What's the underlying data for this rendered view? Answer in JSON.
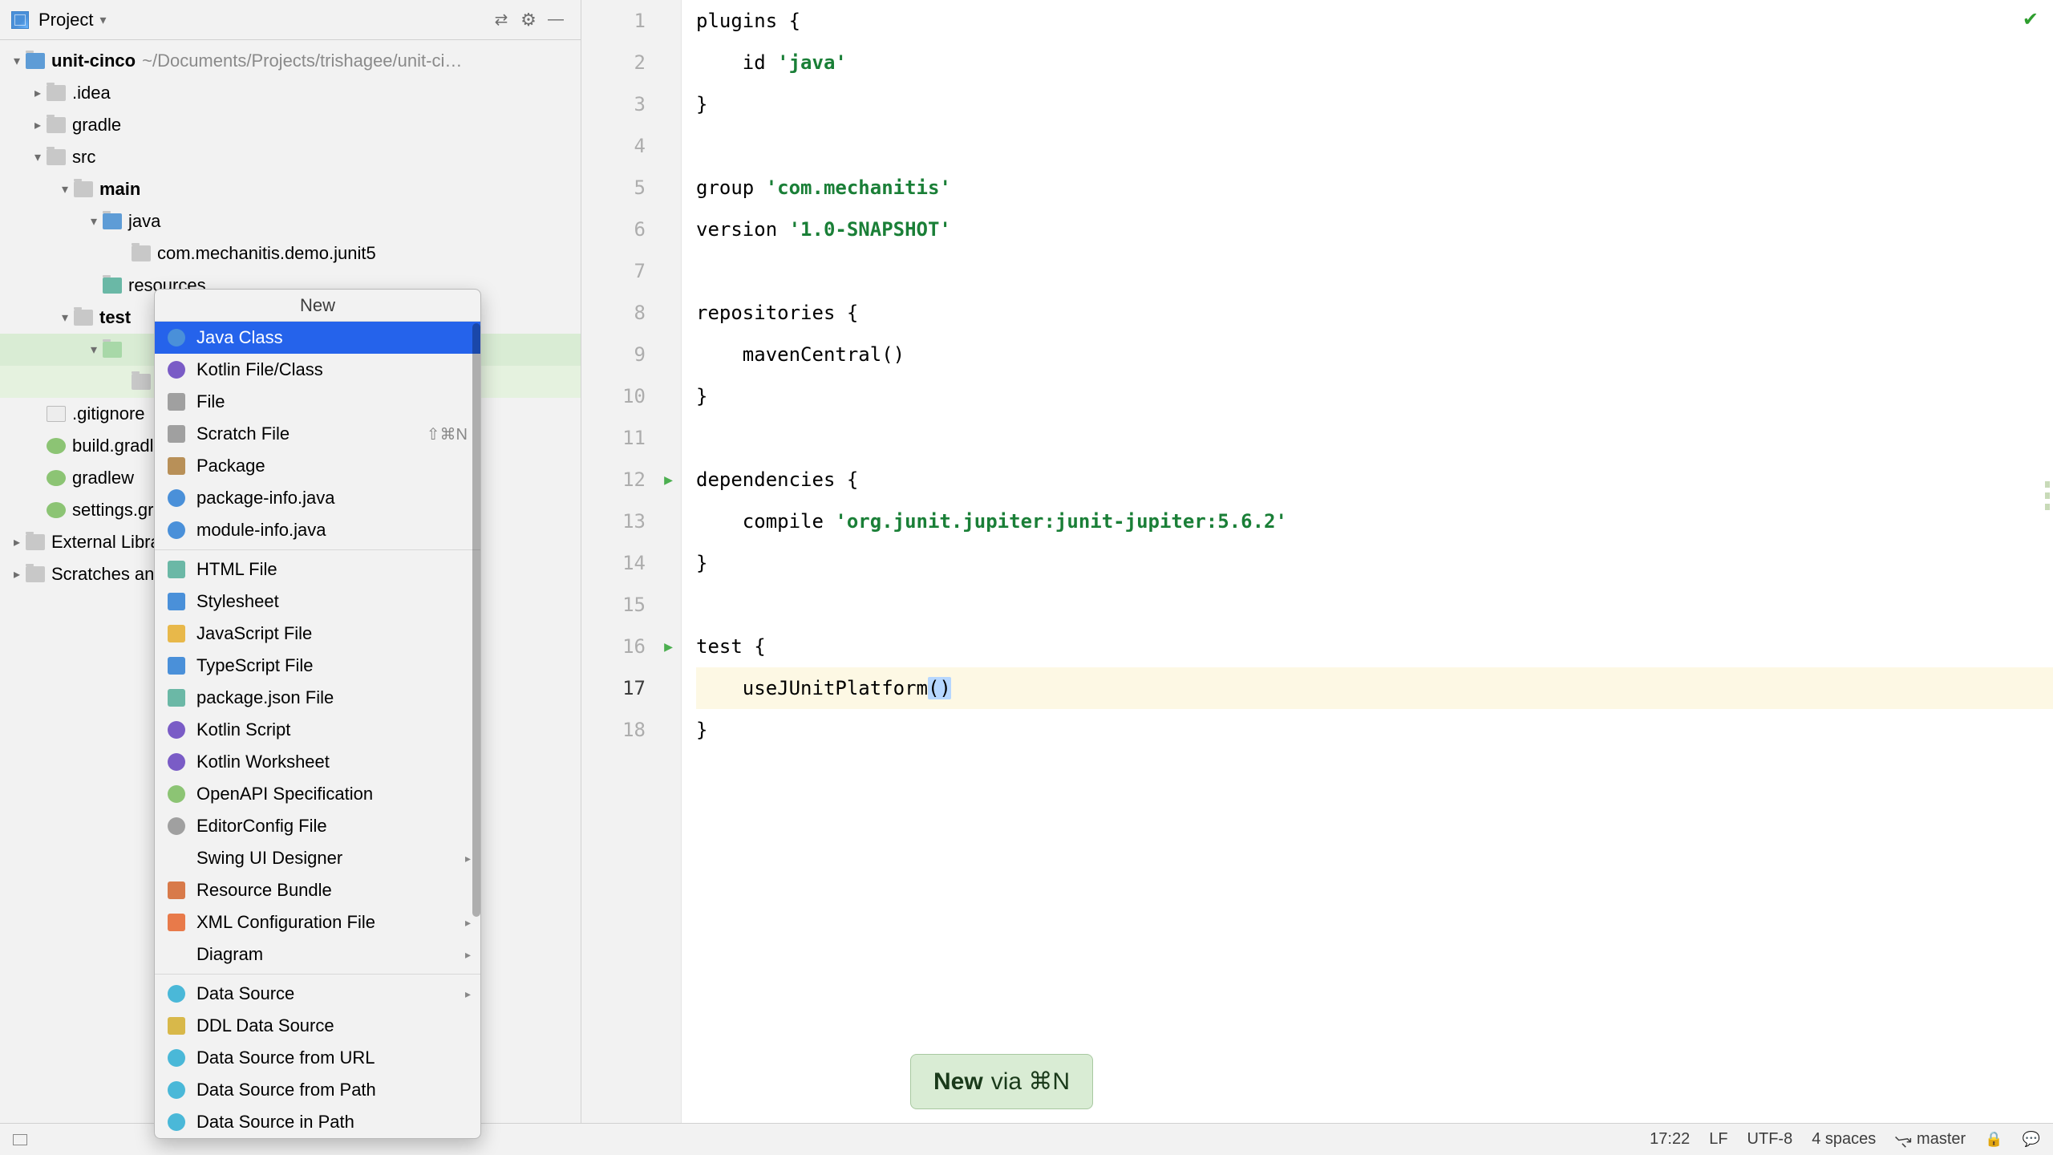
{
  "panel": {
    "title": "Project"
  },
  "tree": {
    "root": {
      "name": "unit-cinco",
      "path": "~/Documents/Projects/trishagee/unit-ci…"
    },
    "idea": ".idea",
    "gradle": "gradle",
    "src": "src",
    "main": "main",
    "java": "java",
    "pack": "com.mechanitis.demo.junit5",
    "resources": "resources",
    "test": "test",
    "gitignore": ".gitignore",
    "build": "build.gradle",
    "gradlew": "gradlew",
    "settings": "settings.gradle",
    "external": "External Libraries",
    "scratches": "Scratches and Consoles"
  },
  "popup": {
    "title": "New",
    "items": [
      {
        "label": "Java Class",
        "selected": true,
        "icon": "ic-c"
      },
      {
        "label": "Kotlin File/Class",
        "icon": "ic-k"
      },
      {
        "label": "File",
        "icon": "ic-f"
      },
      {
        "label": "Scratch File",
        "icon": "ic-f",
        "shortcut": "⇧⌘N"
      },
      {
        "label": "Package",
        "icon": "ic-pkg"
      },
      {
        "label": "package-info.java",
        "icon": "ic-c"
      },
      {
        "label": "module-info.java",
        "icon": "ic-c"
      },
      {
        "divider": true
      },
      {
        "label": "HTML File",
        "icon": "ic-html"
      },
      {
        "label": "Stylesheet",
        "icon": "ic-css"
      },
      {
        "label": "JavaScript File",
        "icon": "ic-js"
      },
      {
        "label": "TypeScript File",
        "icon": "ic-ts"
      },
      {
        "label": "package.json File",
        "icon": "ic-json"
      },
      {
        "label": "Kotlin Script",
        "icon": "ic-k"
      },
      {
        "label": "Kotlin Worksheet",
        "icon": "ic-k"
      },
      {
        "label": "OpenAPI Specification",
        "icon": "ic-api"
      },
      {
        "label": "EditorConfig File",
        "icon": "ic-gear"
      },
      {
        "label": "Swing UI Designer",
        "submenu": true
      },
      {
        "label": "Resource Bundle",
        "icon": "ic-rb"
      },
      {
        "label": "XML Configuration File",
        "icon": "ic-xml",
        "submenu": true
      },
      {
        "label": "Diagram",
        "submenu": true
      },
      {
        "divider": true
      },
      {
        "label": "Data Source",
        "icon": "ic-db",
        "submenu": true
      },
      {
        "label": "DDL Data Source",
        "icon": "ic-ddl"
      },
      {
        "label": "Data Source from URL",
        "icon": "ic-db"
      },
      {
        "label": "Data Source from Path",
        "icon": "ic-db"
      },
      {
        "label": "Data Source in Path",
        "icon": "ic-db"
      }
    ]
  },
  "editor": {
    "max_line": 18,
    "active_line": 17
  },
  "code": {
    "l1a": "plugins ",
    "l1b": "{",
    "l2a": "    id ",
    "l2b": "'java'",
    "l3": "}",
    "l5a": "group ",
    "l5b": "'com.mechanitis'",
    "l6a": "version ",
    "l6b": "'1.0-SNAPSHOT'",
    "l8a": "repositories ",
    "l8b": "{",
    "l9": "    mavenCentral()",
    "l10": "}",
    "l12a": "dependencies ",
    "l12b": "{",
    "l13a": "    compile ",
    "l13b": "'org.junit.jupiter:junit-jupiter:5.6.2'",
    "l14": "}",
    "l16a": "test ",
    "l16b": "{",
    "l17a": "    useJUnitPlatform",
    "l18": "}"
  },
  "tip": {
    "bold": "New",
    "text": " via ⌘N"
  },
  "status": {
    "time": "17:22",
    "enc1": "LF",
    "enc2": "UTF-8",
    "indent": "4 spaces",
    "branch": "master"
  }
}
